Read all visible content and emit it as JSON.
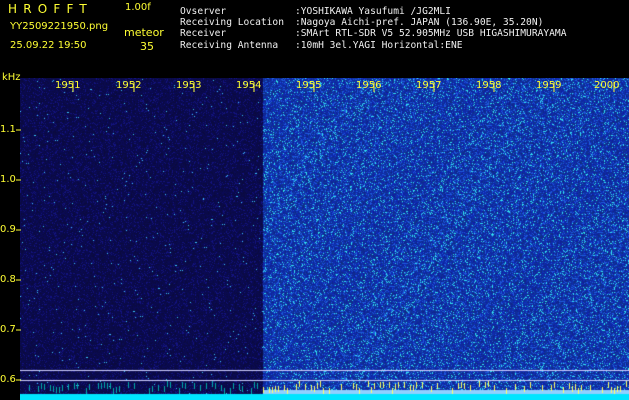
{
  "header": {
    "app_title": "HROFFT",
    "version": "1.00f",
    "filename": "YY2509221950.png",
    "datetime": "25.09.22 19:50",
    "meteor_label": "meteor",
    "meteor_count": "35"
  },
  "info": [
    {
      "key": "Ovserver",
      "value": ":YOSHIKAWA Yasufumi /JG2MLI"
    },
    {
      "key": "Receiving Location",
      "value": ":Nagoya Aichi-pref. JAPAN (136.90E, 35.20N)"
    },
    {
      "key": "Receiver",
      "value": ":SMArt RTL-SDR V5 52.905MHz USB HIGASHIMURAYAMA"
    },
    {
      "key": "Receiving Antenna",
      "value": ":10mH 3el.YAGI Horizontal:ENE"
    }
  ],
  "axis": {
    "unit": "kHz",
    "y_ticks": [
      "1.1",
      "1.0",
      "0.9",
      "0.8",
      "0.7",
      "0.6"
    ],
    "x_ticks": [
      "1951",
      "1952",
      "1953",
      "1954",
      "1955",
      "1956",
      "1957",
      "1958",
      "1959",
      "2000"
    ]
  },
  "colors": {
    "label_yellow": "#ffff33",
    "text_white": "#f0f0f0",
    "dark_region": "#0a0a55",
    "bright_region": "#1a2fb0",
    "noise_cyan": "#33ffff"
  }
}
